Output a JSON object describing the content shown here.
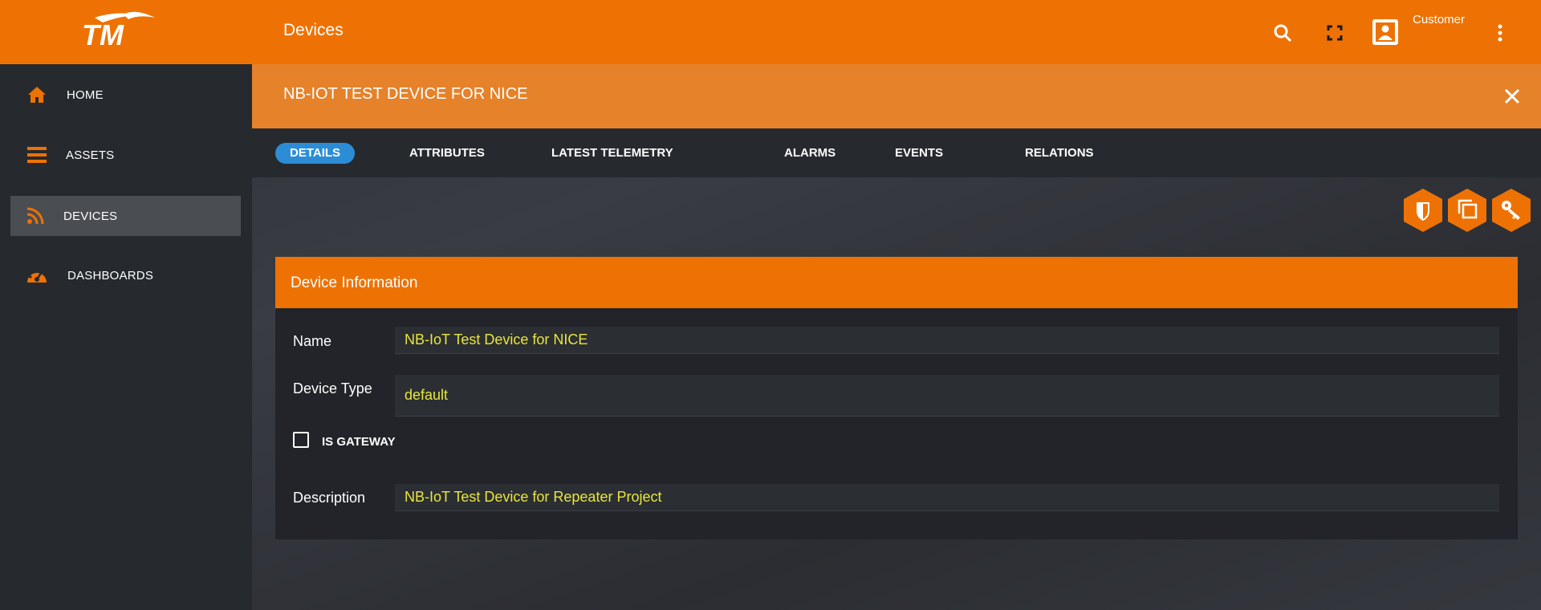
{
  "brand": {
    "logo_text": "TM",
    "accent_color": "#ee7203"
  },
  "sidebar": {
    "items": [
      {
        "label": "HOME",
        "icon": "home-icon"
      },
      {
        "label": "ASSETS",
        "icon": "menu-icon"
      },
      {
        "label": "DEVICES",
        "icon": "rss-icon",
        "active": true
      },
      {
        "label": "DASHBOARDS",
        "icon": "dashboard-icon"
      }
    ]
  },
  "header": {
    "title": "Devices",
    "user_label": "Customer",
    "icons": [
      "search-icon",
      "fullscreen-icon",
      "account-box-icon",
      "more-vert-icon"
    ]
  },
  "entity": {
    "title": "NB-IOT TEST DEVICE FOR NICE"
  },
  "tabs": [
    {
      "label": "DETAILS",
      "active": true
    },
    {
      "label": "ATTRIBUTES"
    },
    {
      "label": "LATEST TELEMETRY"
    },
    {
      "label": "ALARMS"
    },
    {
      "label": "EVENTS"
    },
    {
      "label": "RELATIONS"
    }
  ],
  "actions": [
    "shield-icon",
    "copy-icon",
    "key-icon"
  ],
  "card": {
    "title": "Device Information",
    "fields": {
      "name_label": "Name",
      "name_value": "NB-IoT Test Device for NICE",
      "type_label": "Device Type",
      "type_value": "default",
      "gateway_label": "IS GATEWAY",
      "gateway_checked": false,
      "description_label": "Description",
      "description_value": "NB-IoT Test Device for Repeater Project"
    }
  },
  "colors": {
    "field_text": "#e8e63c",
    "tab_active": "#2c8dd6",
    "entity_bar": "#e5822a"
  }
}
